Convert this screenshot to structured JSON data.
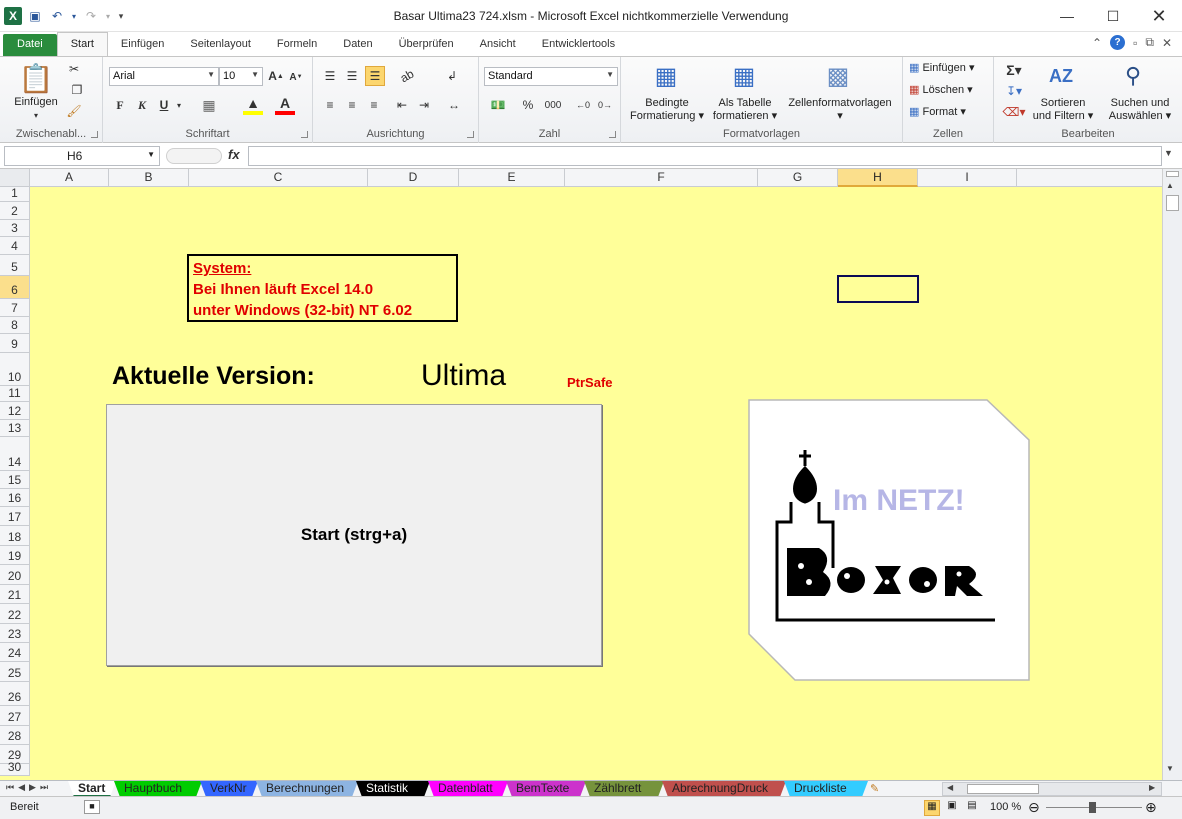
{
  "window": {
    "title": "Basar Ultima23 724.xlsm  -  Microsoft Excel nichtkommerzielle Verwendung",
    "app_icon": "X"
  },
  "ribbon_tabs": [
    "Datei",
    "Start",
    "Einfügen",
    "Seitenlayout",
    "Formeln",
    "Daten",
    "Überprüfen",
    "Ansicht",
    "Entwicklertools"
  ],
  "ribbon": {
    "clipboard": {
      "paste_label": "Einfügen",
      "group": "Zwischenabl..."
    },
    "font": {
      "name": "Arial",
      "size": "10",
      "bold": "F",
      "italic": "K",
      "underline": "U",
      "group": "Schriftart"
    },
    "alignment": {
      "group": "Ausrichtung"
    },
    "number": {
      "format": "Standard",
      "percent": "%",
      "thousands": "000",
      "group": "Zahl"
    },
    "styles": {
      "conditional_1": "Bedingte",
      "conditional_2": "Formatierung",
      "table_1": "Als Tabelle",
      "table_2": "formatieren",
      "cell_styles": "Zellenformatvorlagen",
      "group": "Formatvorlagen"
    },
    "cells": {
      "insert": "Einfügen",
      "delete": "Löschen",
      "format": "Format",
      "group": "Zellen"
    },
    "editing": {
      "sort_1": "Sortieren",
      "sort_2": "und Filtern",
      "find_1": "Suchen und",
      "find_2": "Auswählen",
      "group": "Bearbeiten"
    }
  },
  "formula_bar": {
    "name_box": "H6",
    "fx": "fx",
    "value": ""
  },
  "columns": [
    "A",
    "B",
    "C",
    "D",
    "E",
    "F",
    "G",
    "H",
    "I"
  ],
  "rows": [
    "1",
    "2",
    "3",
    "4",
    "5",
    "6",
    "7",
    "8",
    "9",
    "10",
    "11",
    "12",
    "13",
    "14",
    "15",
    "16",
    "17",
    "18",
    "19",
    "20",
    "21",
    "22",
    "23",
    "24",
    "25",
    "26",
    "27",
    "28",
    "29",
    "30"
  ],
  "sheet": {
    "system_title": "System:",
    "system_line1": "Bei Ihnen läuft Excel 14.0",
    "system_line2": "unter Windows (32-bit) NT 6.02",
    "version_label": "Aktuelle Version:",
    "version_value": "Ultima",
    "ptrsafe": "PtrSafe",
    "start_button": "Start (strg+a)",
    "logo_text": "Im NETZ!",
    "logo_word": "Basar"
  },
  "sheet_tabs": [
    {
      "label": "Start",
      "color": "#ffffff"
    },
    {
      "label": "Hauptbuch",
      "color": "#00cc00"
    },
    {
      "label": "VerkNr",
      "color": "#3366ff"
    },
    {
      "label": "Berechnungen",
      "color": "#8db4e2"
    },
    {
      "label": "Statistik",
      "color": "#000000"
    },
    {
      "label": "Datenblatt",
      "color": "#ff00ff"
    },
    {
      "label": "BemTexte",
      "color": "#cc33cc"
    },
    {
      "label": "Zählbrett",
      "color": "#76933c"
    },
    {
      "label": "AbrechnungDruck",
      "color": "#c0504d"
    },
    {
      "label": "Druckliste",
      "color": "#33ccff"
    }
  ],
  "status": {
    "ready": "Bereit",
    "zoom": "100 %"
  }
}
